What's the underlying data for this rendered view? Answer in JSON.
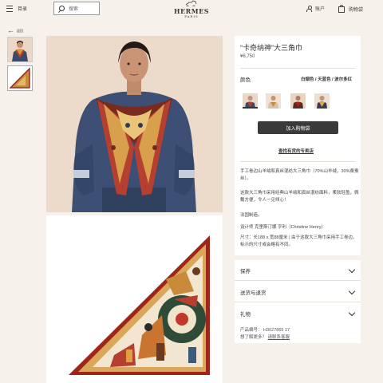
{
  "header": {
    "menu_label": "目录",
    "search_placeholder": "搜索",
    "logo_name": "HERMES",
    "logo_city": "PARIS",
    "account_label": "账户",
    "bag_label": "购物袋"
  },
  "nav": {
    "back_label": "返回"
  },
  "product": {
    "title": "“卡奇纳神”大三角巾",
    "price": "¥6,750",
    "color_label": "颜色",
    "color_value": "白烟色 / 天蓝色 / 波尔多红",
    "swatches": [
      "swatch-1",
      "swatch-2",
      "swatch-3",
      "swatch-4"
    ],
    "add_to_cart": "加入购物袋",
    "find_store": "查找有货的专卖店",
    "desc1": "手工卷边山羊绒和真丝混纺大三角巾（70%山羊绒，30%桑蚕丝）。",
    "desc2": "这款大三角巾采用经典山羊绒和真丝混纺面料，柔软轻盈，佩戴方便，令人一见倾心！",
    "desc3": "法国制造。",
    "desc4": "设计师 克里斯汀娜 亨利（Christine Henry）",
    "desc5": "尺寸：长188 x 宽88厘米 | 由于这款大三角巾采用手工卷边，标示的尺寸或会略有不同。"
  },
  "accordion": [
    "保养",
    "送货与退货",
    "礼物"
  ],
  "meta": {
    "ref_label": "产品编号：",
    "ref_value": "H3627865 17",
    "more_label": "想了解更多？",
    "contact_label": "请联系客服"
  },
  "colors": {
    "accent": "#3a3a3a",
    "background": "#f6f1eb"
  }
}
